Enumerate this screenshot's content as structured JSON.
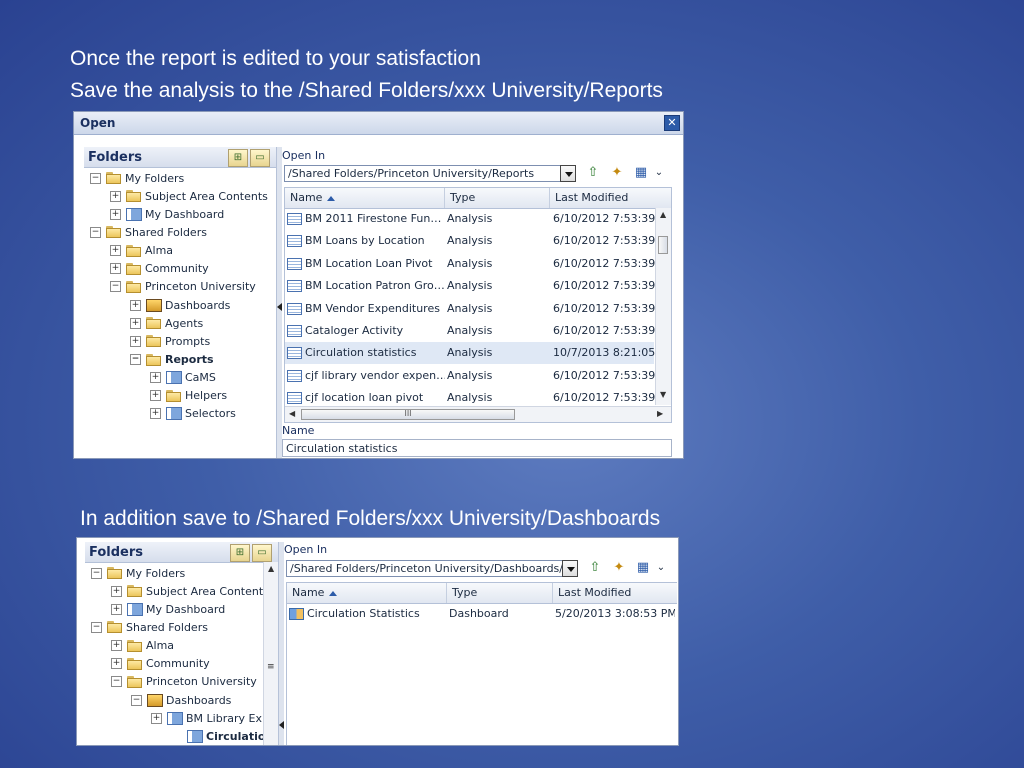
{
  "captions": {
    "line1": "Once the report is edited to your satisfaction",
    "line2": "Save the analysis to the /Shared Folders/xxx University/Reports",
    "line3": "In addition save to /Shared Folders/xxx University/Dashboards"
  },
  "dialog1": {
    "title": "Open",
    "close_glyph": "✕",
    "folders_title": "Folders",
    "tree": [
      {
        "label": "My Folders",
        "expander": "⊟",
        "icon": "folder-open-icon"
      },
      {
        "label": "Subject Area Contents",
        "expander": "⊞",
        "icon": "folder-icon"
      },
      {
        "label": "My Dashboard",
        "expander": "⊞",
        "icon": "dashboard-folder-icon"
      },
      {
        "label": "Shared Folders",
        "expander": "⊟",
        "icon": "folder-open-icon"
      },
      {
        "label": "Alma",
        "expander": "⊞",
        "icon": "folder-icon"
      },
      {
        "label": "Community",
        "expander": "⊞",
        "icon": "folder-icon"
      },
      {
        "label": "Princeton University",
        "expander": "⊟",
        "icon": "folder-open-icon"
      },
      {
        "label": "Dashboards",
        "expander": "⊞",
        "icon": "dashboards-icon"
      },
      {
        "label": "Agents",
        "expander": "⊞",
        "icon": "folder-icon"
      },
      {
        "label": "Prompts",
        "expander": "⊞",
        "icon": "folder-icon"
      },
      {
        "label": "Reports",
        "expander": "⊟",
        "icon": "folder-open-icon"
      },
      {
        "label": "CaMS",
        "expander": "⊞",
        "icon": "dashboard-folder-icon"
      },
      {
        "label": "Helpers",
        "expander": "⊞",
        "icon": "folder-icon"
      },
      {
        "label": "Selectors",
        "expander": "⊞",
        "icon": "dashboard-folder-icon"
      }
    ],
    "open_in_label": "Open In",
    "path": "/Shared Folders/Princeton University/Reports",
    "columns": {
      "name": "Name",
      "type": "Type",
      "modified": "Last Modified"
    },
    "rows": [
      {
        "name": "BM 2011 Firestone Fun…",
        "type": "Analysis",
        "modified": "6/10/2012 7:53:39"
      },
      {
        "name": "BM Loans by Location",
        "type": "Analysis",
        "modified": "6/10/2012 7:53:39"
      },
      {
        "name": "BM Location Loan Pivot",
        "type": "Analysis",
        "modified": "6/10/2012 7:53:39"
      },
      {
        "name": "BM Location Patron Gro…",
        "type": "Analysis",
        "modified": "6/10/2012 7:53:39"
      },
      {
        "name": "BM Vendor Expenditures",
        "type": "Analysis",
        "modified": "6/10/2012 7:53:39"
      },
      {
        "name": "Cataloger Activity",
        "type": "Analysis",
        "modified": "6/10/2012 7:53:39"
      },
      {
        "name": "Circulation statistics",
        "type": "Analysis",
        "modified": "10/7/2013 8:21:05"
      },
      {
        "name": "cjf library vendor expen…",
        "type": "Analysis",
        "modified": "6/10/2012 7:53:39"
      },
      {
        "name": "cjf location loan pivot",
        "type": "Analysis",
        "modified": "6/10/2012 7:53:39"
      }
    ],
    "hscroll_grip": "III",
    "name_label": "Name",
    "name_value": "Circulation statistics"
  },
  "dialog2": {
    "folders_title": "Folders",
    "tree": [
      {
        "label": "My Folders",
        "expander": "⊟",
        "icon": "folder-open-icon"
      },
      {
        "label": "Subject Area Contents",
        "expander": "⊞",
        "icon": "folder-icon"
      },
      {
        "label": "My Dashboard",
        "expander": "⊞",
        "icon": "dashboard-folder-icon"
      },
      {
        "label": "Shared Folders",
        "expander": "⊟",
        "icon": "folder-open-icon"
      },
      {
        "label": "Alma",
        "expander": "⊞",
        "icon": "folder-icon"
      },
      {
        "label": "Community",
        "expander": "⊞",
        "icon": "folder-icon"
      },
      {
        "label": "Princeton University",
        "expander": "⊟",
        "icon": "folder-open-icon"
      },
      {
        "label": "Dashboards",
        "expander": "⊟",
        "icon": "dashboards-icon"
      },
      {
        "label": "BM Library Exp",
        "expander": "⊞",
        "icon": "dashboard-folder-icon"
      },
      {
        "label": "Circulation S",
        "expander": "",
        "icon": "dashboard-folder-icon"
      }
    ],
    "open_in_label": "Open In",
    "path": "/Shared Folders/Princeton University/Dashboards/Cir",
    "columns": {
      "name": "Name",
      "type": "Type",
      "modified": "Last Modified"
    },
    "rows": [
      {
        "name": "Circulation Statistics",
        "type": "Dashboard",
        "modified": "5/20/2013 3:08:53 PM"
      }
    ]
  }
}
